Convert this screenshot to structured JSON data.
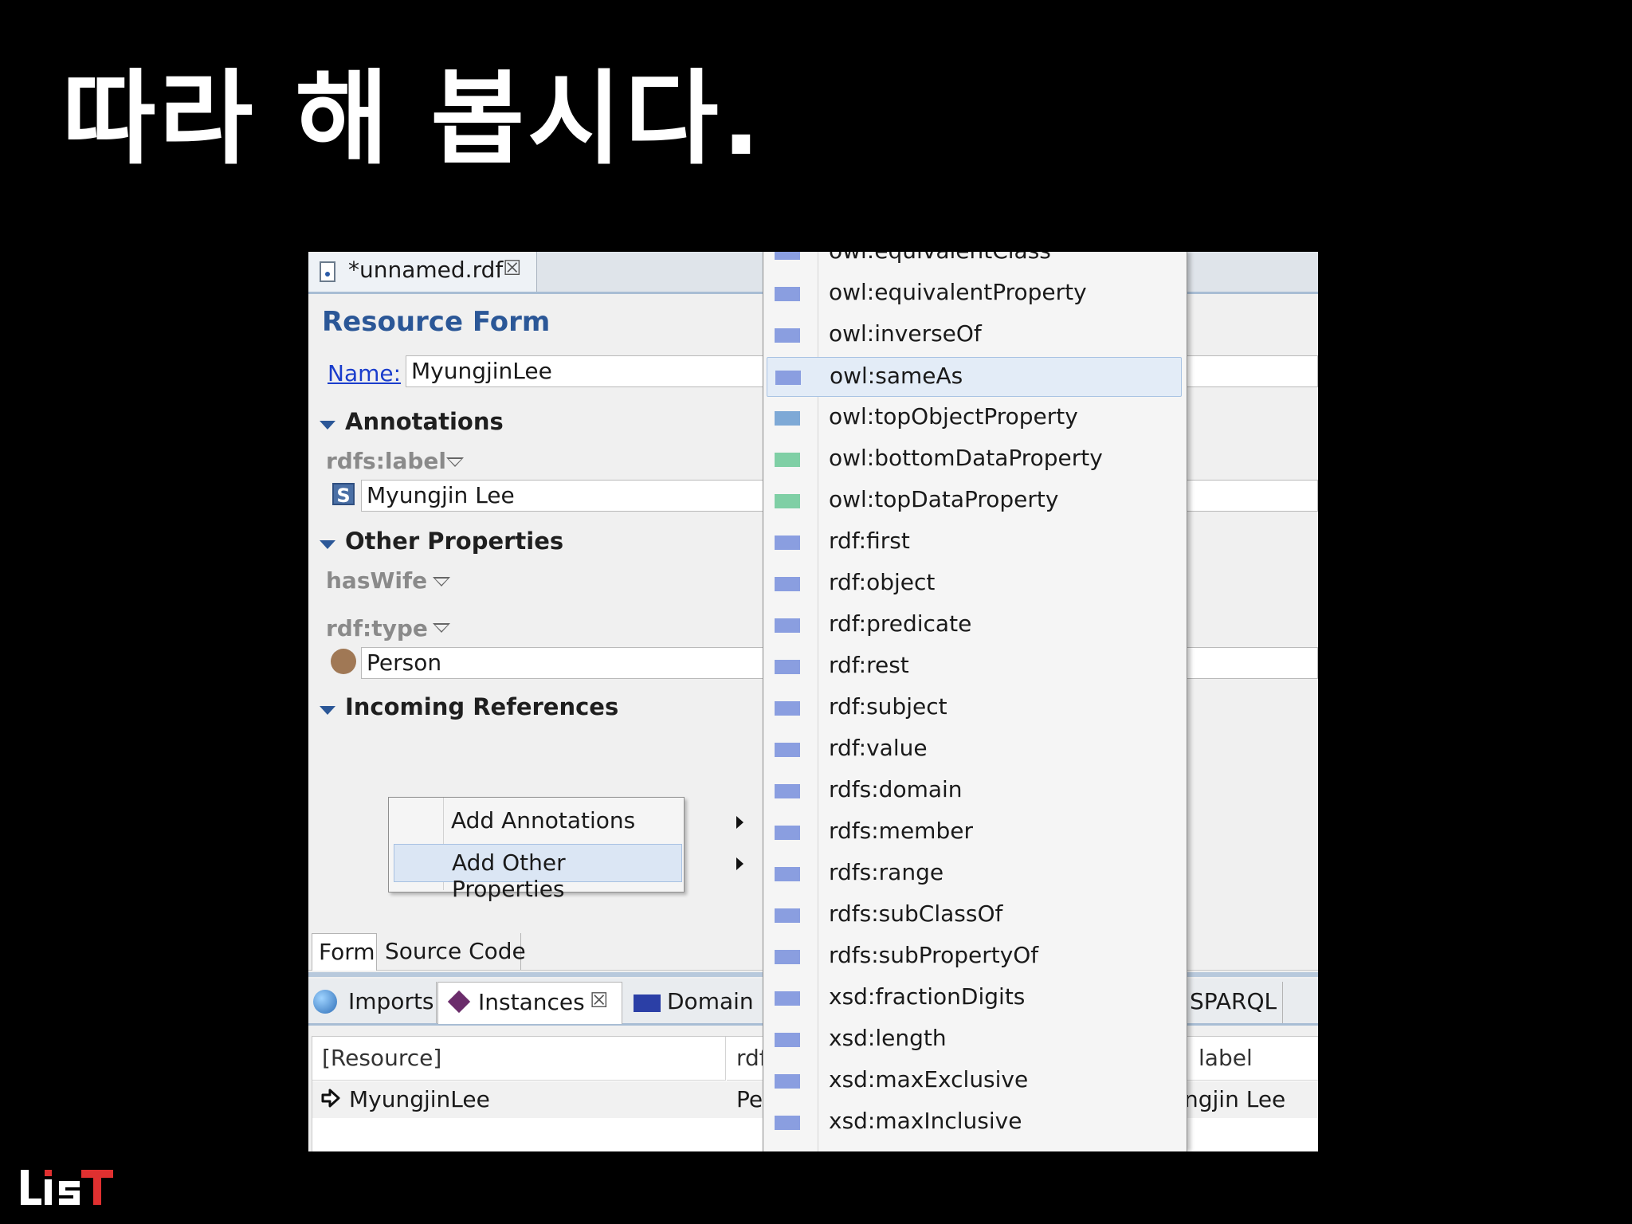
{
  "slide": {
    "title": "따라 해 봅시다.",
    "logo_text": "LiST"
  },
  "colors": {
    "object_property": "#8a9ee0",
    "top_object_property": "#7ea9d6",
    "data_property": "#7fcfa5",
    "form_title": "#2b5797",
    "person_icon": "#a07855"
  },
  "editor": {
    "tab_label": "*unnamed.rdf",
    "tab_close": "☒",
    "form_title": "Resource Form",
    "name_label": "Name:",
    "name_value": "MyungjinLee",
    "annotations": {
      "header": "Annotations",
      "property": "rdfs:label",
      "value_icon": "S",
      "value": "Myungjin Lee"
    },
    "other_properties": {
      "header": "Other Properties",
      "prop1": "hasWife",
      "prop2": "rdf:type",
      "type_value": "Person"
    },
    "incoming": {
      "header": "Incoming References"
    }
  },
  "context_menu": {
    "items": [
      {
        "label": "Add Annotations"
      },
      {
        "label": "Add Other Properties"
      }
    ]
  },
  "bottom_tabs": [
    {
      "label": "Form"
    },
    {
      "label": "Source Code"
    }
  ],
  "view_tabs": {
    "imports": "Imports",
    "instances": "Instances",
    "instances_close": "☒",
    "domain": "Domain",
    "sparql": "SPARQL"
  },
  "table": {
    "headers": [
      "[Resource]",
      "rdf",
      "label"
    ],
    "row": [
      "MyungjinLee",
      "Pe",
      "ngjin Lee"
    ]
  },
  "property_list": [
    {
      "label": "owl:equivalentClass",
      "icon": "object-property"
    },
    {
      "label": "owl:equivalentProperty",
      "icon": "object-property"
    },
    {
      "label": "owl:inverseOf",
      "icon": "object-property"
    },
    {
      "label": "owl:sameAs",
      "icon": "object-property"
    },
    {
      "label": "owl:topObjectProperty",
      "icon": "top-object-property"
    },
    {
      "label": "owl:bottomDataProperty",
      "icon": "data-property"
    },
    {
      "label": "owl:topDataProperty",
      "icon": "data-property"
    },
    {
      "label": "rdf:first",
      "icon": "object-property"
    },
    {
      "label": "rdf:object",
      "icon": "object-property"
    },
    {
      "label": "rdf:predicate",
      "icon": "object-property"
    },
    {
      "label": "rdf:rest",
      "icon": "object-property"
    },
    {
      "label": "rdf:subject",
      "icon": "object-property"
    },
    {
      "label": "rdf:value",
      "icon": "object-property"
    },
    {
      "label": "rdfs:domain",
      "icon": "object-property"
    },
    {
      "label": "rdfs:member",
      "icon": "object-property"
    },
    {
      "label": "rdfs:range",
      "icon": "object-property"
    },
    {
      "label": "rdfs:subClassOf",
      "icon": "object-property"
    },
    {
      "label": "rdfs:subPropertyOf",
      "icon": "object-property"
    },
    {
      "label": "xsd:fractionDigits",
      "icon": "object-property"
    },
    {
      "label": "xsd:length",
      "icon": "object-property"
    },
    {
      "label": "xsd:maxExclusive",
      "icon": "object-property"
    },
    {
      "label": "xsd:maxInclusive",
      "icon": "object-property"
    }
  ],
  "property_list_highlighted": "owl:sameAs"
}
